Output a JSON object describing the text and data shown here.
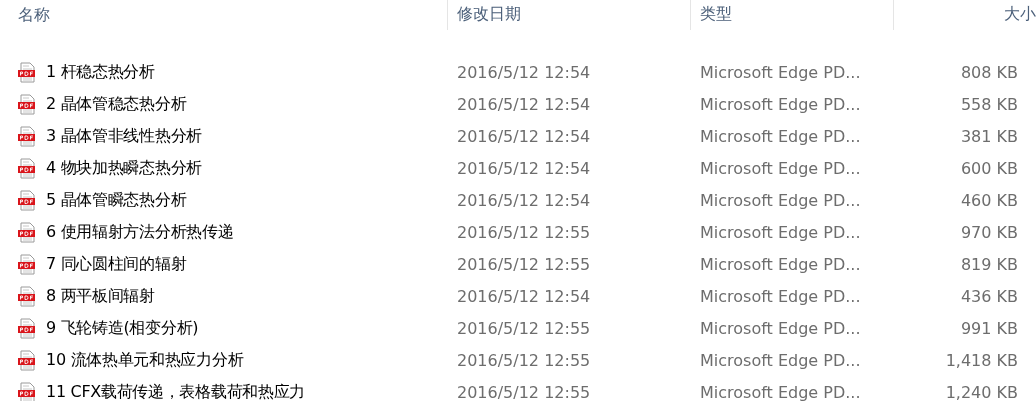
{
  "columns": [
    "名称",
    "修改日期",
    "类型",
    "大小"
  ],
  "rows": [
    {
      "name": "1 杆稳态热分析",
      "date": "2016/5/12 12:54",
      "type": "Microsoft Edge PD...",
      "size": "808 KB"
    },
    {
      "name": "2 晶体管稳态热分析",
      "date": "2016/5/12 12:54",
      "type": "Microsoft Edge PD...",
      "size": "558 KB"
    },
    {
      "name": "3 晶体管非线性热分析",
      "date": "2016/5/12 12:54",
      "type": "Microsoft Edge PD...",
      "size": "381 KB"
    },
    {
      "name": "4 物块加热瞬态热分析",
      "date": "2016/5/12 12:54",
      "type": "Microsoft Edge PD...",
      "size": "600 KB"
    },
    {
      "name": "5 晶体管瞬态热分析",
      "date": "2016/5/12 12:54",
      "type": "Microsoft Edge PD...",
      "size": "460 KB"
    },
    {
      "name": "6 使用辐射方法分析热传递",
      "date": "2016/5/12 12:55",
      "type": "Microsoft Edge PD...",
      "size": "970 KB"
    },
    {
      "name": "7 同心圆柱间的辐射",
      "date": "2016/5/12 12:55",
      "type": "Microsoft Edge PD...",
      "size": "819 KB"
    },
    {
      "name": "8 两平板间辐射",
      "date": "2016/5/12 12:54",
      "type": "Microsoft Edge PD...",
      "size": "436 KB"
    },
    {
      "name": "9 飞轮铸造(相变分析)",
      "date": "2016/5/12 12:55",
      "type": "Microsoft Edge PD...",
      "size": "991 KB"
    },
    {
      "name": "10 流体热单元和热应力分析",
      "date": "2016/5/12 12:55",
      "type": "Microsoft Edge PD...",
      "size": "1,418 KB"
    },
    {
      "name": "11 CFX载荷传递，表格载荷和热应力",
      "date": "2016/5/12 12:55",
      "type": "Microsoft Edge PD...",
      "size": "1,240 KB"
    }
  ]
}
